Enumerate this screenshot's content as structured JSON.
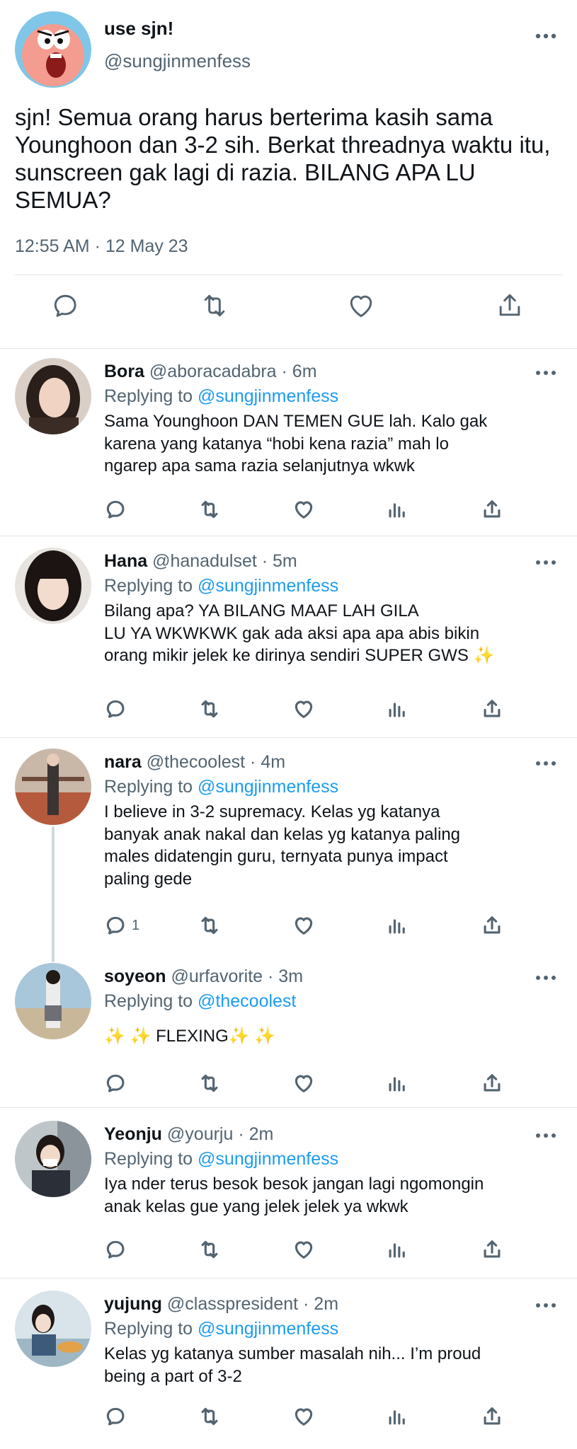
{
  "main_tweet": {
    "name": "use sjn!",
    "handle": "@sungjinmenfess",
    "text": "sjn! Semua orang harus berterima kasih sama Younghoon dan 3-2 sih. Berkat threadnya waktu itu, sunscreen gak lagi di razia. BILANG APA LU SEMUA?",
    "timestamp": "12:55 AM · 12 May 23",
    "actions": [
      "reply-icon",
      "retweet-icon",
      "like-icon",
      "share-icon"
    ]
  },
  "replies": [
    {
      "name": "Bora",
      "meta": "@aboracadabra · 6m",
      "replying_prefix": "Replying to",
      "replying_to": "@sungjinmenfess",
      "text": "Sama Younghoon DAN TEMEN GUE lah. Kalo gak\nkarena yang katanya “hobi kena razia” mah lo\nngarep apa sama razia selanjutnya wkwk",
      "reply_count": ""
    },
    {
      "name": "Hana",
      "meta": "@hanadulset · 5m",
      "replying_prefix": "Replying to",
      "replying_to": "@sungjinmenfess",
      "text": "Bilang apa? YA BILANG MAAF LAH GILA\nLU YA WKWKWK gak ada aksi apa apa abis bikin\norang mikir jelek ke dirinya sendiri SUPER GWS",
      "sparkle_suffix": "✨",
      "reply_count": ""
    },
    {
      "name": "nara",
      "meta": "@thecoolest · 4m",
      "replying_prefix": "Replying to",
      "replying_to": "@sungjinmenfess",
      "text": "I believe in 3-2 supremacy. Kelas yg katanya\nbanyak anak nakal dan kelas yg katanya paling\nmales didatengin guru, ternyata punya impact\npaling gede",
      "reply_count": "1"
    },
    {
      "name": "soyeon",
      "meta": "@urfavorite · 3m",
      "replying_prefix": "Replying to",
      "replying_to": "@thecoolest",
      "text": "FLEXING",
      "sparkles": "✨ ✨",
      "reply_count": ""
    },
    {
      "name": "Yeonju",
      "meta": "@yourju · 2m",
      "replying_prefix": "Replying to",
      "replying_to": "@sungjinmenfess",
      "text": "Iya nder terus besok besok jangan lagi ngomongin\nanak kelas gue yang jelek jelek ya wkwk",
      "reply_count": ""
    },
    {
      "name": "yujung",
      "meta": "@classpresident · 2m",
      "replying_prefix": "Replying to",
      "replying_to": "@sungjinmenfess",
      "text": "Kelas yg katanya sumber masalah nih... I’m proud\nbeing a part of 3-2",
      "reply_count": ""
    }
  ],
  "colors": {
    "text": "#0f1419",
    "secondary": "#536471",
    "link": "#1d9bf0",
    "divider": "#e1e4e8"
  }
}
